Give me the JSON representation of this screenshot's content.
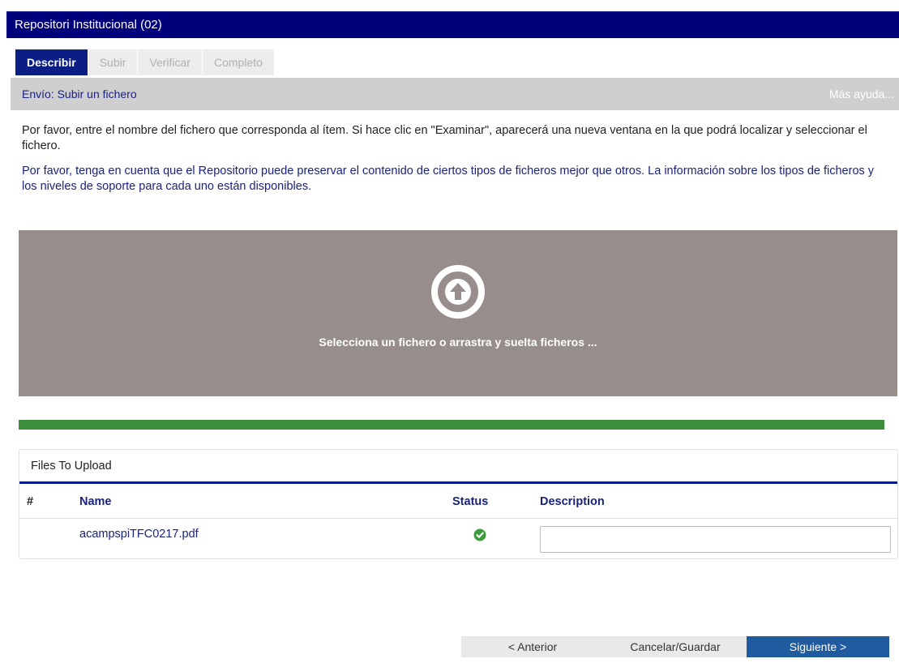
{
  "header": {
    "title": "Repositori Institucional (02)"
  },
  "tabs": [
    {
      "label": "Describir",
      "active": true
    },
    {
      "label": "Subir",
      "active": false
    },
    {
      "label": "Verificar",
      "active": false
    },
    {
      "label": "Completo",
      "active": false
    }
  ],
  "section": {
    "title": "Envío: Subir un fichero",
    "help_link": "Más ayuda..."
  },
  "instructions": {
    "p1": "Por favor, entre el nombre del fichero que corresponda al ítem. Si hace clic en \"Examinar\", aparecerá una nueva ventana en la que podrá localizar y seleccionar el fichero.",
    "p2": "Por favor, tenga en cuenta que el Repositorio puede preservar el contenido de ciertos tipos de ficheros mejor que otros. La información sobre los tipos de ficheros y los niveles de soporte para cada uno están disponibles."
  },
  "dropzone": {
    "icon": "upload-arrow-icon",
    "text": "Selecciona un fichero o arrastra y suelta ficheros ..."
  },
  "upload_progress": {
    "percent": 100,
    "color": "#3d8f3d"
  },
  "files_panel": {
    "title": "Files To Upload",
    "columns": {
      "index": "#",
      "name": "Name",
      "status": "Status",
      "description": "Description"
    },
    "rows": [
      {
        "index": "",
        "name": "acampspiTFC0217.pdf",
        "status_icon": "check-circle-icon",
        "status_color": "#3d9b3d",
        "description": ""
      }
    ]
  },
  "footer": {
    "prev_label": "< Anterior",
    "cancel_label": "Cancelar/Guardar",
    "next_label": "Siguiente >"
  },
  "colors": {
    "title_bar": "#00007a",
    "active_tab": "#0a1e86",
    "dropzone_bg": "#978d8a",
    "next_button": "#1f5b9e"
  }
}
